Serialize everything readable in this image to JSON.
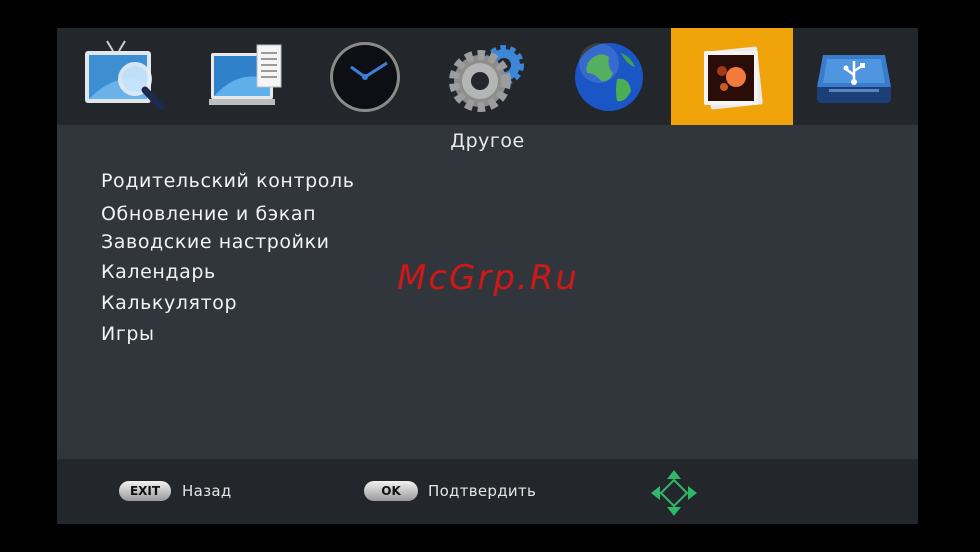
{
  "tabs": [
    {
      "icon": "tv-search-icon",
      "active": false
    },
    {
      "icon": "monitor-settings-icon",
      "active": false
    },
    {
      "icon": "clock-icon",
      "active": false
    },
    {
      "icon": "gears-icon",
      "active": false
    },
    {
      "icon": "globe-icon",
      "active": false
    },
    {
      "icon": "photos-icon",
      "active": true
    },
    {
      "icon": "usb-drive-icon",
      "active": false
    }
  ],
  "page": {
    "title": "Другое"
  },
  "menu": {
    "items": [
      {
        "label": "Родительский контроль"
      },
      {
        "label": "Обновление и бэкап"
      },
      {
        "label": "Заводские настройки"
      },
      {
        "label": "Календарь"
      },
      {
        "label": "Калькулятор"
      },
      {
        "label": "Игры"
      }
    ]
  },
  "watermark": "McGrp.Ru",
  "footer": {
    "exit_key": "EXIT",
    "exit_label": "Назад",
    "ok_key": "OK",
    "ok_label": "Подтвердить"
  },
  "colors": {
    "active_tab": "#f0a40a",
    "background": "#31363d",
    "bar": "#23262b",
    "watermark": "#d01818"
  }
}
